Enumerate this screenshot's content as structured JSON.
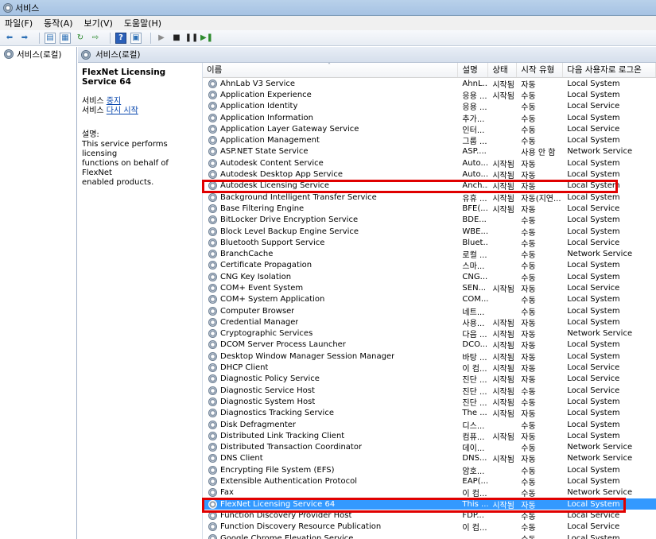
{
  "window": {
    "title": "서비스"
  },
  "menu": [
    "파일(F)",
    "동작(A)",
    "보기(V)",
    "도움말(H)"
  ],
  "tree": {
    "root_label": "서비스(로컬)"
  },
  "panel_header": {
    "label": "서비스(로컬)"
  },
  "details": {
    "service_name": "FlexNet Licensing Service 64",
    "service_prefix": "서비스",
    "stop_link": "중지",
    "restart_link": "다시 시작",
    "desc_label": "설명:",
    "desc_lines": [
      "This service performs licensing",
      "functions on behalf of FlexNet",
      "enabled products."
    ]
  },
  "columns": {
    "name": "이름",
    "desc": "설명",
    "state": "상태",
    "start": "시작 유형",
    "logon": "다음 사용자로 로그온"
  },
  "rows": [
    {
      "name": "AhnLab V3 Service",
      "desc": "AhnL...",
      "state": "시작됨",
      "start": "자동",
      "logon": "Local System"
    },
    {
      "name": "Application Experience",
      "desc": "응용 ...",
      "state": "시작됨",
      "start": "수동",
      "logon": "Local System"
    },
    {
      "name": "Application Identity",
      "desc": "응용 ...",
      "state": "",
      "start": "수동",
      "logon": "Local Service"
    },
    {
      "name": "Application Information",
      "desc": "추가...",
      "state": "",
      "start": "수동",
      "logon": "Local System"
    },
    {
      "name": "Application Layer Gateway Service",
      "desc": "인터...",
      "state": "",
      "start": "수동",
      "logon": "Local Service"
    },
    {
      "name": "Application Management",
      "desc": "그룹 ...",
      "state": "",
      "start": "수동",
      "logon": "Local System"
    },
    {
      "name": "ASP.NET State Service",
      "desc": "ASP....",
      "state": "",
      "start": "사용 안 함",
      "logon": "Network Service"
    },
    {
      "name": "Autodesk Content Service",
      "desc": "Auto...",
      "state": "시작됨",
      "start": "자동",
      "logon": "Local System"
    },
    {
      "name": "Autodesk Desktop App Service",
      "desc": "Auto...",
      "state": "시작됨",
      "start": "자동",
      "logon": "Local System"
    },
    {
      "name": "Autodesk Licensing Service",
      "desc": "Anch...",
      "state": "시작됨",
      "start": "자동",
      "logon": "Local System"
    },
    {
      "name": "Background Intelligent Transfer Service",
      "desc": "유휴 ...",
      "state": "시작됨",
      "start": "자동(지연...",
      "logon": "Local System"
    },
    {
      "name": "Base Filtering Engine",
      "desc": "BFE(...",
      "state": "시작됨",
      "start": "자동",
      "logon": "Local Service"
    },
    {
      "name": "BitLocker Drive Encryption Service",
      "desc": "BDE...",
      "state": "",
      "start": "수동",
      "logon": "Local System"
    },
    {
      "name": "Block Level Backup Engine Service",
      "desc": "WBE...",
      "state": "",
      "start": "수동",
      "logon": "Local System"
    },
    {
      "name": "Bluetooth Support Service",
      "desc": "Bluet...",
      "state": "",
      "start": "수동",
      "logon": "Local Service"
    },
    {
      "name": "BranchCache",
      "desc": "로컬 ...",
      "state": "",
      "start": "수동",
      "logon": "Network Service"
    },
    {
      "name": "Certificate Propagation",
      "desc": "스마...",
      "state": "",
      "start": "수동",
      "logon": "Local System"
    },
    {
      "name": "CNG Key Isolation",
      "desc": "CNG...",
      "state": "",
      "start": "수동",
      "logon": "Local System"
    },
    {
      "name": "COM+ Event System",
      "desc": "SEN...",
      "state": "시작됨",
      "start": "자동",
      "logon": "Local Service"
    },
    {
      "name": "COM+ System Application",
      "desc": "COM...",
      "state": "",
      "start": "수동",
      "logon": "Local System"
    },
    {
      "name": "Computer Browser",
      "desc": "네트...",
      "state": "",
      "start": "수동",
      "logon": "Local System"
    },
    {
      "name": "Credential Manager",
      "desc": "사용...",
      "state": "시작됨",
      "start": "자동",
      "logon": "Local System"
    },
    {
      "name": "Cryptographic Services",
      "desc": "다음 ...",
      "state": "시작됨",
      "start": "자동",
      "logon": "Network Service"
    },
    {
      "name": "DCOM Server Process Launcher",
      "desc": "DCO...",
      "state": "시작됨",
      "start": "자동",
      "logon": "Local System"
    },
    {
      "name": "Desktop Window Manager Session Manager",
      "desc": "바탕 ...",
      "state": "시작됨",
      "start": "자동",
      "logon": "Local System"
    },
    {
      "name": "DHCP Client",
      "desc": "이 컴...",
      "state": "시작됨",
      "start": "자동",
      "logon": "Local Service"
    },
    {
      "name": "Diagnostic Policy Service",
      "desc": "진단 ...",
      "state": "시작됨",
      "start": "자동",
      "logon": "Local Service"
    },
    {
      "name": "Diagnostic Service Host",
      "desc": "진단 ...",
      "state": "시작됨",
      "start": "수동",
      "logon": "Local Service"
    },
    {
      "name": "Diagnostic System Host",
      "desc": "진단 ...",
      "state": "시작됨",
      "start": "수동",
      "logon": "Local System"
    },
    {
      "name": "Diagnostics Tracking Service",
      "desc": "The ...",
      "state": "시작됨",
      "start": "자동",
      "logon": "Local System"
    },
    {
      "name": "Disk Defragmenter",
      "desc": "디스...",
      "state": "",
      "start": "수동",
      "logon": "Local System"
    },
    {
      "name": "Distributed Link Tracking Client",
      "desc": "컴퓨...",
      "state": "시작됨",
      "start": "자동",
      "logon": "Local System"
    },
    {
      "name": "Distributed Transaction Coordinator",
      "desc": "데이...",
      "state": "",
      "start": "수동",
      "logon": "Network Service"
    },
    {
      "name": "DNS Client",
      "desc": "DNS...",
      "state": "시작됨",
      "start": "자동",
      "logon": "Network Service"
    },
    {
      "name": "Encrypting File System (EFS)",
      "desc": "암호...",
      "state": "",
      "start": "수동",
      "logon": "Local System"
    },
    {
      "name": "Extensible Authentication Protocol",
      "desc": "EAP(...",
      "state": "",
      "start": "수동",
      "logon": "Local System"
    },
    {
      "name": "Fax",
      "desc": "이 컴...",
      "state": "",
      "start": "수동",
      "logon": "Network Service"
    },
    {
      "name": "FlexNet Licensing Service 64",
      "desc": "This ...",
      "state": "시작됨",
      "start": "자동",
      "logon": "Local System",
      "selected": true
    },
    {
      "name": "Function Discovery Provider Host",
      "desc": "FDP...",
      "state": "",
      "start": "수동",
      "logon": "Local Service"
    },
    {
      "name": "Function Discovery Resource Publication",
      "desc": "이 컴...",
      "state": "",
      "start": "수동",
      "logon": "Local Service"
    },
    {
      "name": "Google Chrome Elevation Service",
      "desc": "",
      "state": "",
      "start": "수동",
      "logon": "Local System"
    }
  ],
  "colors": {
    "selection": "#3399ff",
    "highlight_box": "#e00000"
  }
}
